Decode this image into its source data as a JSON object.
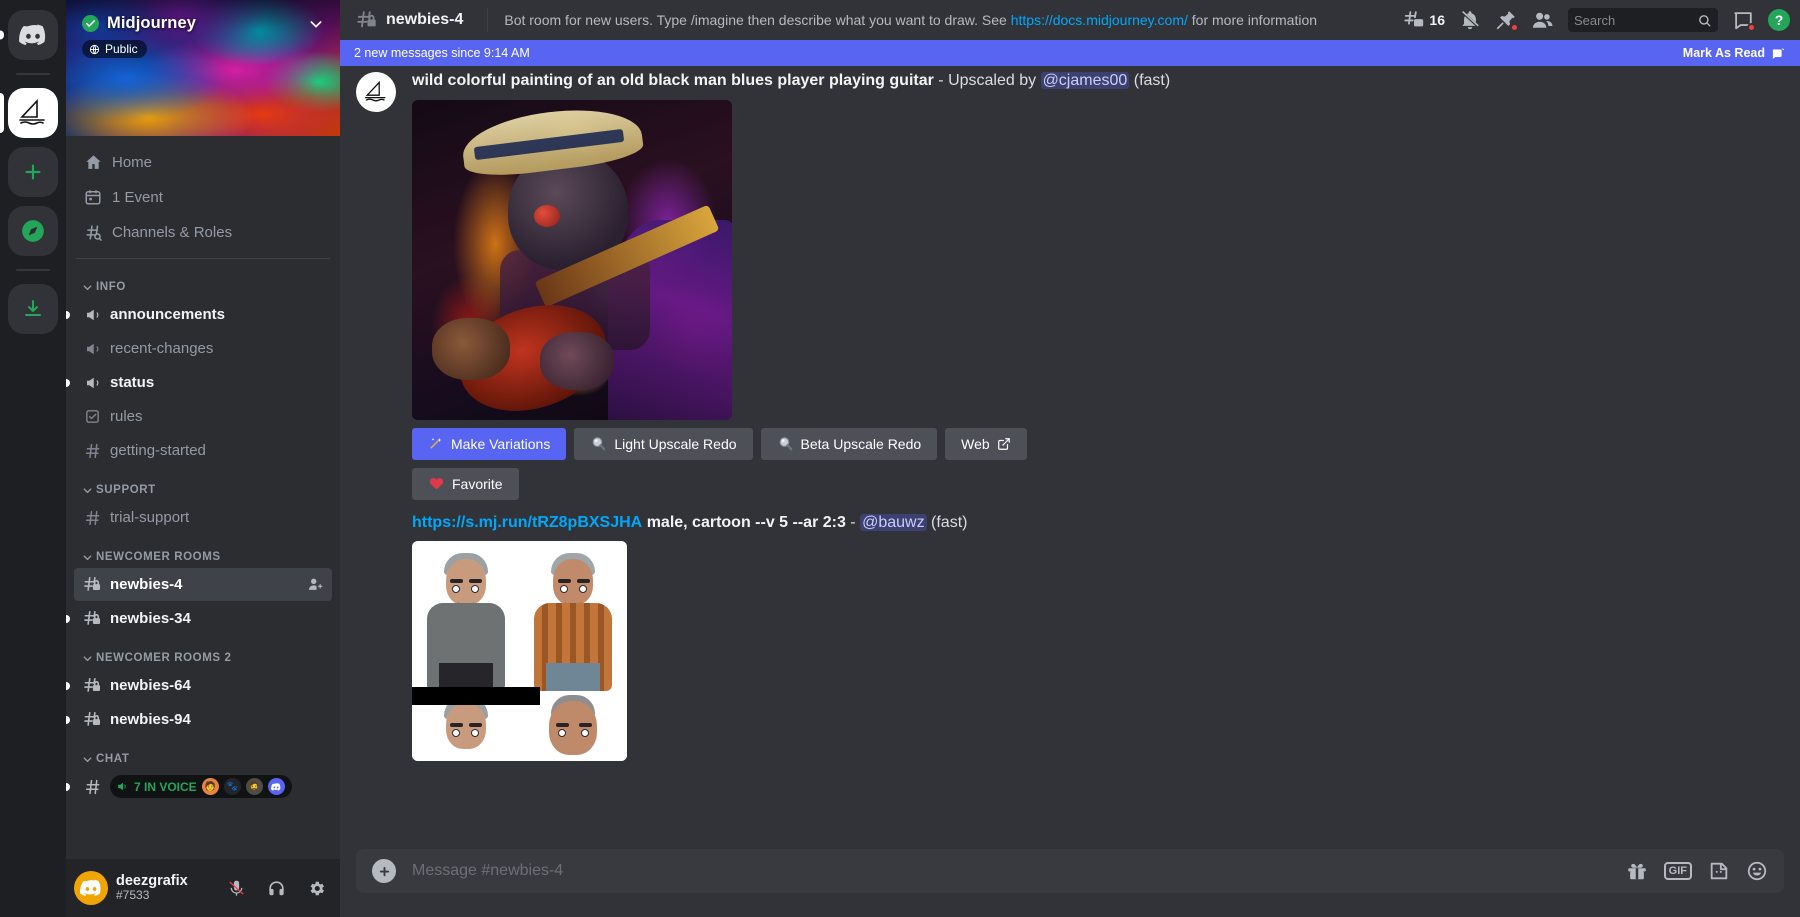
{
  "rail": {
    "items": [
      {
        "name": "direct-messages",
        "icon": "discord-logo"
      },
      {
        "name": "midjourney-server",
        "icon": "sailboat",
        "active": true
      },
      {
        "name": "add-server",
        "icon": "plus"
      },
      {
        "name": "explore-servers",
        "icon": "compass"
      },
      {
        "name": "download-apps",
        "icon": "download"
      }
    ]
  },
  "server": {
    "name": "Midjourney",
    "privacy_badge": "Public",
    "verified": true
  },
  "sidebar": {
    "nav": [
      {
        "label": "Home",
        "icon": "home-icon"
      },
      {
        "label": "1 Event",
        "icon": "calendar-icon"
      },
      {
        "label": "Channels & Roles",
        "icon": "hash-search-icon"
      }
    ],
    "categories": [
      {
        "name": "INFO",
        "channels": [
          {
            "label": "announcements",
            "icon": "announcement-icon",
            "unread": true,
            "dot": true
          },
          {
            "label": "recent-changes",
            "icon": "announcement-icon",
            "unread": false,
            "dot": false
          },
          {
            "label": "status",
            "icon": "announcement-icon",
            "unread": true,
            "dot": true
          },
          {
            "label": "rules",
            "icon": "rules-icon",
            "unread": false,
            "dot": false
          },
          {
            "label": "getting-started",
            "icon": "hash-icon",
            "unread": false,
            "dot": false
          }
        ]
      },
      {
        "name": "SUPPORT",
        "channels": [
          {
            "label": "trial-support",
            "icon": "hash-icon",
            "unread": false,
            "dot": false
          }
        ]
      },
      {
        "name": "NEWCOMER ROOMS",
        "channels": [
          {
            "label": "newbies-4",
            "icon": "hash-lock-icon",
            "selected": true,
            "dot": false,
            "trailing": "add-member-icon"
          },
          {
            "label": "newbies-34",
            "icon": "hash-lock-icon",
            "unread": true,
            "dot": true
          }
        ]
      },
      {
        "name": "NEWCOMER ROOMS 2",
        "channels": [
          {
            "label": "newbies-64",
            "icon": "hash-lock-icon",
            "unread": true,
            "dot": true
          },
          {
            "label": "newbies-94",
            "icon": "hash-lock-icon",
            "unread": true,
            "dot": true
          }
        ]
      },
      {
        "name": "CHAT",
        "channels": [
          {
            "label": "",
            "icon": "hash-icon",
            "dot": true,
            "voice": {
              "count_label": "7 IN VOICE"
            }
          }
        ]
      }
    ]
  },
  "user": {
    "name": "deezgrafix",
    "tag": "#7533",
    "mic_state": "muted",
    "controls": [
      "mute-icon",
      "deafen-icon",
      "settings-icon"
    ]
  },
  "topbar": {
    "channel_name": "newbies-4",
    "topic_before": "Bot room for new users. Type /imagine then describe what you want to draw. See ",
    "topic_link": "https://docs.midjourney.com/",
    "topic_after": " for more information",
    "threads_count": "16",
    "search_placeholder": "Search",
    "icons": [
      "threads-icon",
      "notifications-muted-icon",
      "pinned-messages-icon",
      "members-icon",
      "inbox-icon",
      "help-icon"
    ]
  },
  "notification_banner": {
    "text": "2 new messages since 9:14 AM",
    "action_label": "Mark As Read",
    "action_icon": "mark-read-icon"
  },
  "messages": [
    {
      "prompt": "wild colorful painting of an old black man blues player playing guitar",
      "separator": " - ",
      "status": "Upscaled by",
      "mention": "@cjames00",
      "speed": "(fast)",
      "buttons": [
        {
          "label": "Make Variations",
          "icon": "magic-wand-icon",
          "style": "primary"
        },
        {
          "label": "Light Upscale Redo",
          "icon": "magnifier-icon",
          "style": "secondary"
        },
        {
          "label": "Beta Upscale Redo",
          "icon": "magnifier-icon",
          "style": "secondary"
        },
        {
          "label": "Web",
          "icon": "external-link-icon",
          "style": "secondary"
        },
        {
          "label": "Favorite",
          "icon": "heart-icon",
          "style": "secondary"
        }
      ]
    },
    {
      "link": "https://s.mj.run/tRZ8pBXSJHA",
      "prompt": "male, cartoon --v 5 --ar 2:3",
      "separator": " - ",
      "mention": "@bauwz",
      "speed": "(fast)"
    }
  ],
  "composer": {
    "placeholder": "Message #newbies-4",
    "icons": [
      "gift-icon",
      "gif-icon",
      "sticker-icon",
      "emoji-icon"
    ],
    "plus_icon": "plus-icon"
  },
  "colors": {
    "brand": "#5865f2",
    "online_green": "#23a55a",
    "sidebar_bg": "#2b2d31",
    "main_bg": "#313338",
    "rail_bg": "#1e1f22",
    "link_blue": "#00a8fc",
    "danger_red": "#f23f43"
  }
}
